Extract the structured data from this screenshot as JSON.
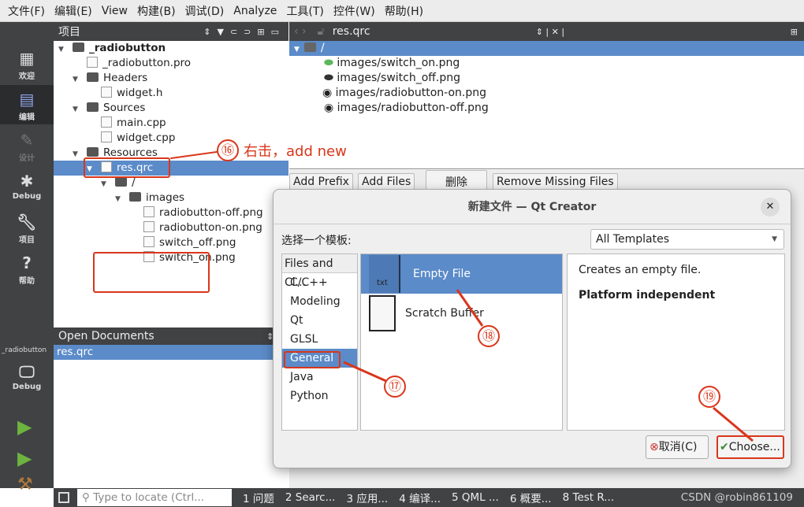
{
  "menu": [
    "文件(F)",
    "编辑(E)",
    "View",
    "构建(B)",
    "调试(D)",
    "Analyze",
    "工具(T)",
    "控件(W)",
    "帮助(H)"
  ],
  "modes": [
    {
      "label": "欢迎",
      "icon": "grid-icon"
    },
    {
      "label": "编辑",
      "icon": "edit-icon"
    },
    {
      "label": "设计",
      "icon": "pencil-icon"
    },
    {
      "label": "Debug",
      "icon": "bug-icon"
    },
    {
      "label": "项目",
      "icon": "wrench-icon"
    },
    {
      "label": "帮助",
      "icon": "help-icon"
    }
  ],
  "target": {
    "project": "_radiobutton",
    "kit": "Debug"
  },
  "project_panel": {
    "title": "项目",
    "tree": [
      {
        "label": "_radiobutton",
        "depth": 0,
        "type": "project",
        "bold": true
      },
      {
        "label": "_radiobutton.pro",
        "depth": 1,
        "type": "file"
      },
      {
        "label": "Headers",
        "depth": 1,
        "type": "folder"
      },
      {
        "label": "widget.h",
        "depth": 2,
        "type": "file"
      },
      {
        "label": "Sources",
        "depth": 1,
        "type": "folder"
      },
      {
        "label": "main.cpp",
        "depth": 2,
        "type": "file"
      },
      {
        "label": "widget.cpp",
        "depth": 2,
        "type": "file"
      },
      {
        "label": "Resources",
        "depth": 1,
        "type": "folder"
      },
      {
        "label": "res.qrc",
        "depth": 2,
        "type": "file",
        "selected": true
      },
      {
        "label": "/",
        "depth": 3,
        "type": "folder"
      },
      {
        "label": "images",
        "depth": 4,
        "type": "folder"
      },
      {
        "label": "radiobutton-off.png",
        "depth": 5,
        "type": "file"
      },
      {
        "label": "radiobutton-on.png",
        "depth": 5,
        "type": "file"
      },
      {
        "label": "switch_off.png",
        "depth": 5,
        "type": "file"
      },
      {
        "label": "switch_on.png",
        "depth": 5,
        "type": "file"
      }
    ]
  },
  "open_documents": {
    "title": "Open Documents",
    "items": [
      "res.qrc"
    ]
  },
  "editor": {
    "tab": "res.qrc",
    "root": "/",
    "files": [
      "images/switch_on.png",
      "images/switch_off.png",
      "images/radiobutton-on.png",
      "images/radiobutton-off.png"
    ],
    "buttons": [
      "Add Prefix",
      "Add Files",
      "删除",
      "Remove Missing Files"
    ]
  },
  "annotations": {
    "a16": "⑯",
    "a16_text": "右击，add new",
    "a17": "⑰",
    "a18": "⑱",
    "a19": "⑲"
  },
  "dialog": {
    "title": "新建文件 — Qt Creator",
    "choose_label": "选择一个模板:",
    "filter": "All Templates",
    "categories": [
      "Files and Cl...",
      "C/C++",
      "Modeling",
      "Qt",
      "GLSL",
      "General",
      "Java",
      "Python"
    ],
    "selected_category": "General",
    "templates": [
      {
        "label": "Empty File",
        "icon_text": "txt"
      },
      {
        "label": "Scratch Buffer"
      }
    ],
    "description": "Creates an empty file.",
    "platform": "Platform independent",
    "cancel": "取消(C)",
    "choose": "Choose..."
  },
  "statusbar": {
    "locate_placeholder": "Type to locate (Ctrl...",
    "tabs": [
      "1 问题",
      "2 Searc...",
      "3 应用...",
      "4 编译...",
      "5 QML ...",
      "6 概要...",
      "8 Test R..."
    ],
    "watermark": "CSDN @robin861109"
  },
  "colors": {
    "selection": "#5b8bc9",
    "annotation": "#d9361b",
    "sidebar": "#404244"
  }
}
